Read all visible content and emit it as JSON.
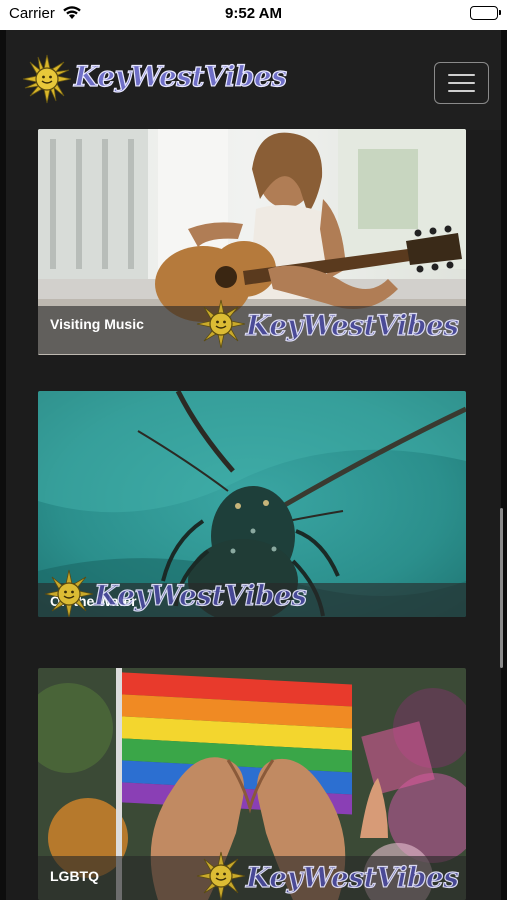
{
  "status_bar": {
    "carrier": "Carrier",
    "time": "9:52 AM"
  },
  "header": {
    "brand": "KeyWestVibes",
    "logo_icon": "sun-logo-icon",
    "menu_icon": "hamburger-menu-icon"
  },
  "cards": [
    {
      "title": "Visiting Music",
      "watermark": "KeyWestVibes",
      "photo": "woman-playing-guitar"
    },
    {
      "title": "On the Water",
      "watermark": "KeyWestVibes",
      "photo": "spiny-lobster-underwater"
    },
    {
      "title": "LGBTQ",
      "watermark": "KeyWestVibes",
      "photo": "rainbow-flag-heart-hands"
    }
  ],
  "colors": {
    "background": "#1c1c1c",
    "brand_text": "#6f6fc7",
    "caption_text": "#ffffff"
  }
}
